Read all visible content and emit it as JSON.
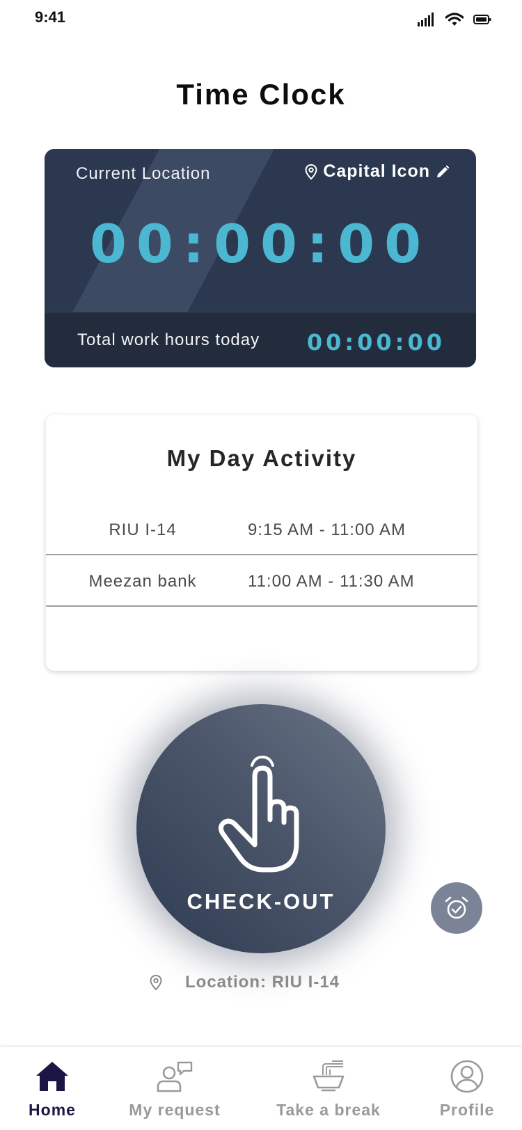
{
  "status_bar": {
    "time": "9:41"
  },
  "page": {
    "title": "Time Clock"
  },
  "timer_card": {
    "location_label": "Current Location",
    "location_value": "Capital Icon",
    "timer": "00:00:00",
    "total_label": "Total work hours today",
    "total_value": "00:00:00"
  },
  "activity": {
    "title": "My Day Activity",
    "rows": [
      {
        "place": "RIU I-14",
        "time": "9:15 AM - 11:00 AM"
      },
      {
        "place": "Meezan bank",
        "time": "11:00 AM - 11:30 AM"
      }
    ]
  },
  "checkout": {
    "label": "CHECK-OUT"
  },
  "location_line": {
    "text": "Location: RIU I-14"
  },
  "nav": {
    "items": [
      {
        "label": "Home",
        "icon": "home-icon"
      },
      {
        "label": "My request",
        "icon": "request-icon"
      },
      {
        "label": "Take a break",
        "icon": "noodle-bowl-icon"
      },
      {
        "label": "Profile",
        "icon": "profile-icon"
      }
    ]
  },
  "colors": {
    "accent": "#4cb7d1",
    "card_dark": "#2b3850",
    "nav_active": "#1b1646"
  }
}
